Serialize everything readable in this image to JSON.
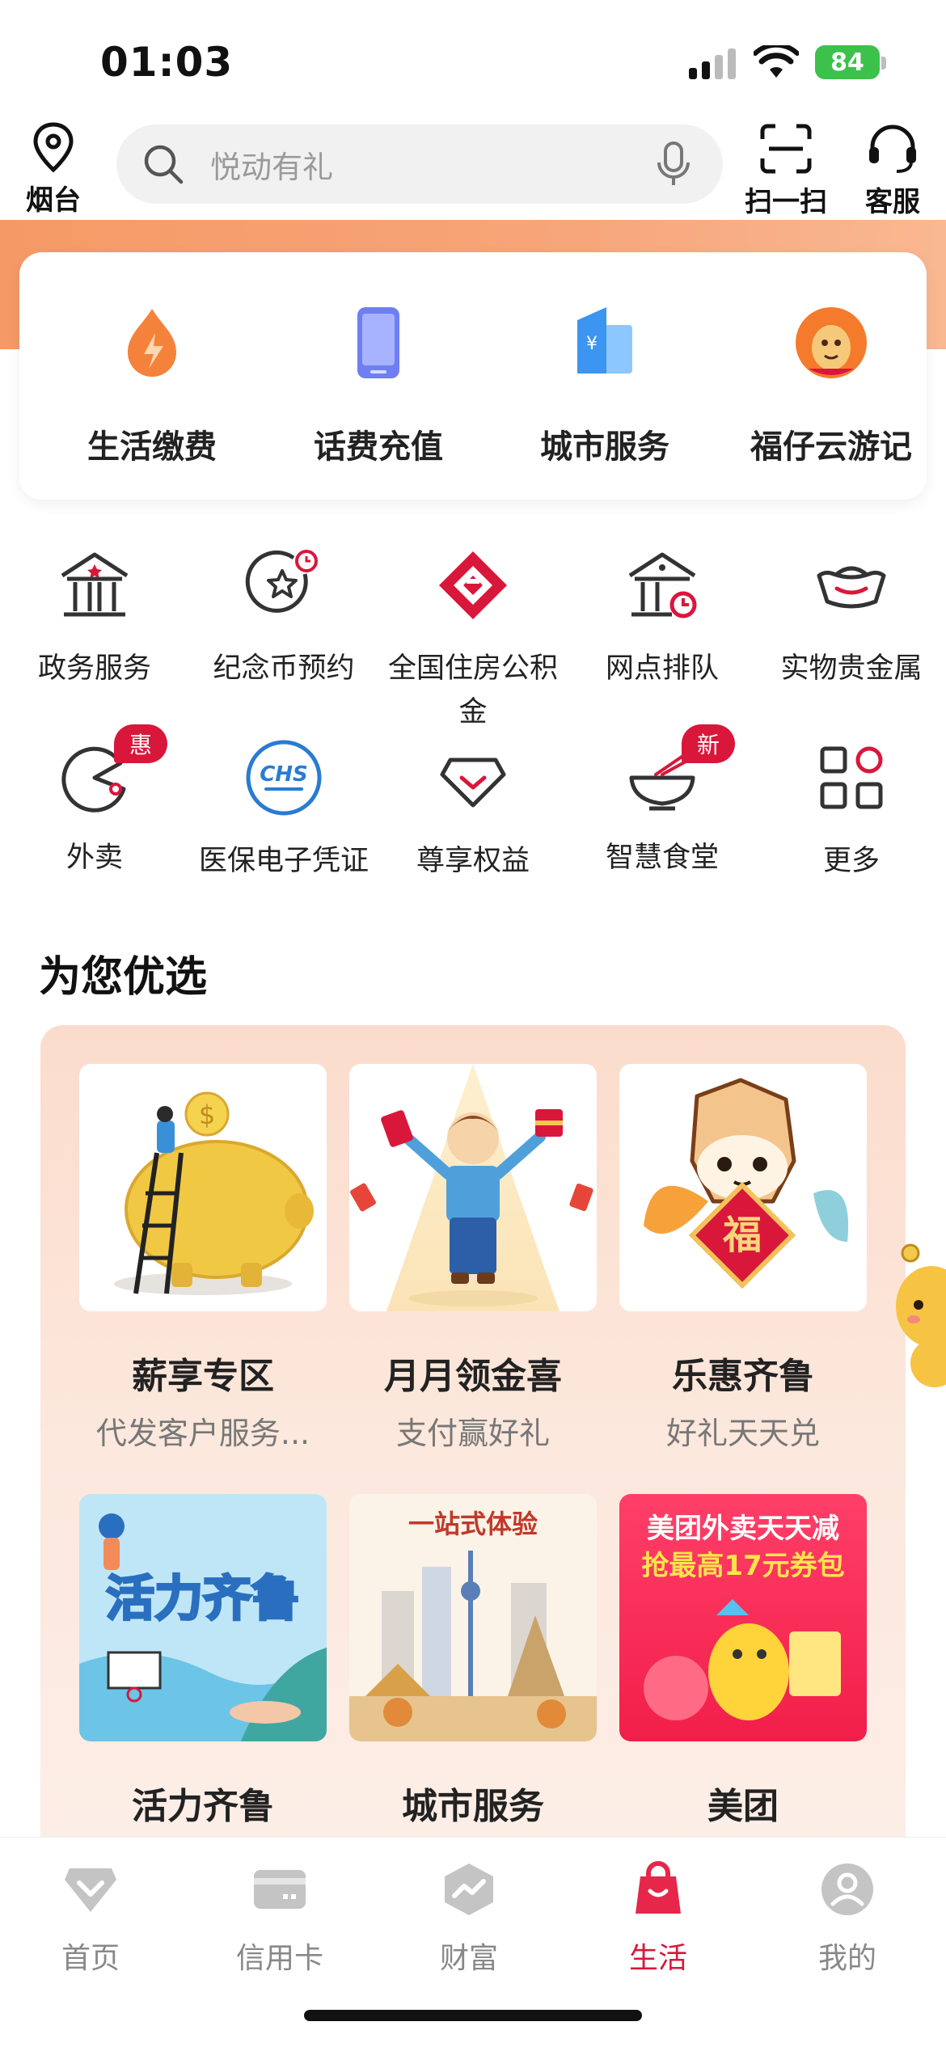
{
  "status_bar": {
    "time": "01:03",
    "battery": "84"
  },
  "header": {
    "location": "烟台",
    "search_placeholder": "悦动有礼",
    "scan_label": "扫一扫",
    "service_label": "客服"
  },
  "top_services": [
    {
      "label": "生活缴费",
      "icon": "fire-drop-icon"
    },
    {
      "label": "话费充值",
      "icon": "phone-icon"
    },
    {
      "label": "城市服务",
      "icon": "city-building-icon"
    },
    {
      "label": "福仔云游记",
      "icon": "mascot-icon"
    }
  ],
  "grid_services": [
    {
      "label": "政务服务",
      "icon": "government-icon"
    },
    {
      "label": "纪念币预约",
      "icon": "coin-star-icon"
    },
    {
      "label": "全国住房公积金",
      "icon": "housing-fund-icon"
    },
    {
      "label": "网点排队",
      "icon": "branch-queue-icon"
    },
    {
      "label": "实物贵金属",
      "icon": "gold-ingot-icon"
    },
    {
      "label": "外卖",
      "icon": "takeout-icon",
      "badge": "惠"
    },
    {
      "label": "医保电子凭证",
      "icon": "chs-icon",
      "icon_text": "CHS"
    },
    {
      "label": "尊享权益",
      "icon": "diamond-icon"
    },
    {
      "label": "智慧食堂",
      "icon": "bowl-icon",
      "badge": "新"
    },
    {
      "label": "更多",
      "icon": "grid-more-icon"
    }
  ],
  "recommend": {
    "title": "为您优选",
    "items": [
      {
        "title": "薪享专区",
        "subtitle": "代发客户服务...",
        "image": "piggy-bank-illustration"
      },
      {
        "title": "月月领金喜",
        "subtitle": "支付赢好礼",
        "image": "boy-gifts-illustration"
      },
      {
        "title": "乐惠齐鲁",
        "subtitle": "好礼天天兑",
        "image": "fu-mascot-illustration",
        "image_text": "福"
      },
      {
        "title": "活力齐鲁",
        "subtitle": "",
        "image": "sports-illustration",
        "image_text": "活力齐鲁"
      },
      {
        "title": "城市服务",
        "subtitle": "",
        "image": "city-illustration",
        "image_text": "一站式体验"
      },
      {
        "title": "美团",
        "subtitle": "",
        "image": "meituan-illustration",
        "image_text_1": "美团外卖天天减",
        "image_text_2": "抢最高17元券包"
      }
    ]
  },
  "tabbar": {
    "tabs": [
      {
        "label": "首页",
        "icon": "home-diamond-icon"
      },
      {
        "label": "信用卡",
        "icon": "credit-card-icon"
      },
      {
        "label": "财富",
        "icon": "wealth-chart-icon"
      },
      {
        "label": "生活",
        "icon": "shopping-bag-icon",
        "active": true
      },
      {
        "label": "我的",
        "icon": "profile-icon"
      }
    ]
  },
  "colors": {
    "accent": "#d9173b",
    "banner": "#f59a66"
  }
}
